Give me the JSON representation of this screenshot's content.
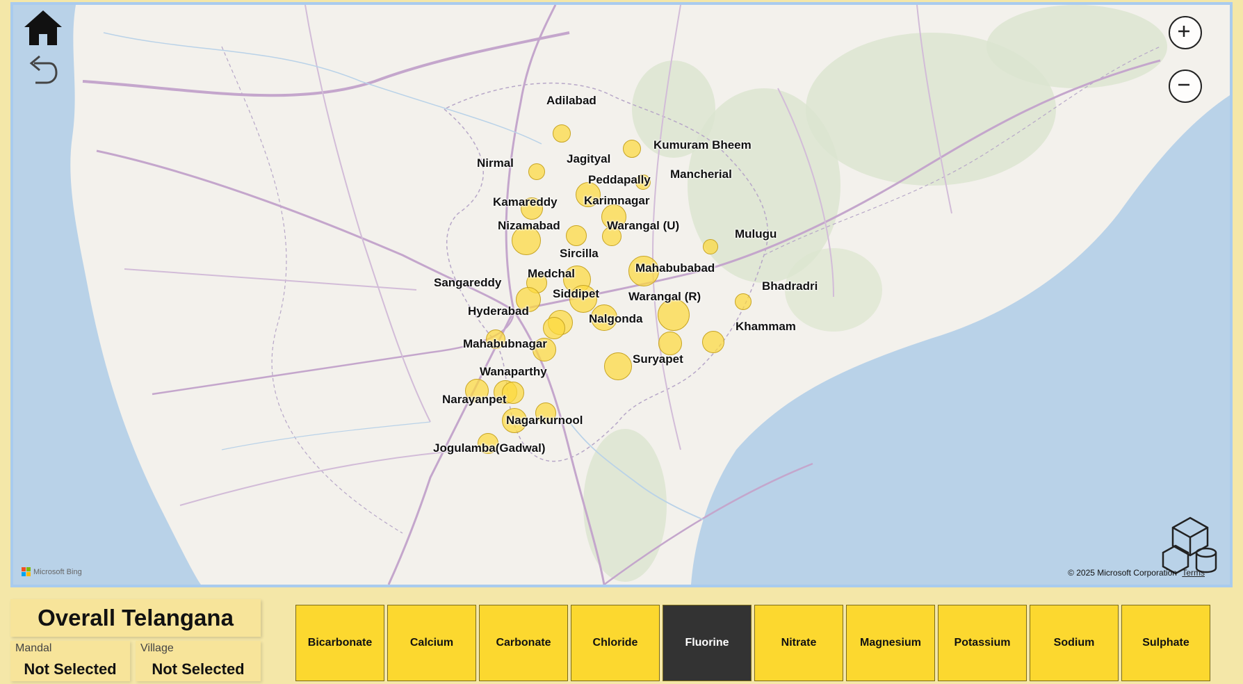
{
  "map": {
    "attribution": "Microsoft Bing",
    "copyright": "© 2025 Microsoft Corporation",
    "terms": "Terms",
    "controls": {
      "home_icon": "home-icon",
      "back_icon": "undo-icon",
      "zoom_in_icon": "plus-icon",
      "zoom_out_icon": "minus-icon",
      "layers_icon": "cube-icon"
    },
    "bubble_color": "#fcd83e",
    "districts": [
      {
        "name": "Adilabad"
      },
      {
        "name": "Kumuram Bheem"
      },
      {
        "name": "Nirmal"
      },
      {
        "name": "Jagityal"
      },
      {
        "name": "Mancherial"
      },
      {
        "name": "Peddapally"
      },
      {
        "name": "Kamareddy"
      },
      {
        "name": "Karimnagar"
      },
      {
        "name": "Nizamabad"
      },
      {
        "name": "Warangal (U)"
      },
      {
        "name": "Mulugu"
      },
      {
        "name": "Sircilla"
      },
      {
        "name": "Mahabubabad"
      },
      {
        "name": "Medchal"
      },
      {
        "name": "Sangareddy"
      },
      {
        "name": "Bhadradri"
      },
      {
        "name": "Siddipet"
      },
      {
        "name": "Warangal (R)"
      },
      {
        "name": "Hyderabad"
      },
      {
        "name": "Nalgonda"
      },
      {
        "name": "Khammam"
      },
      {
        "name": "Mahabubnagar"
      },
      {
        "name": "Suryapet"
      },
      {
        "name": "Wanaparthy"
      },
      {
        "name": "Narayanpet"
      },
      {
        "name": "Nagarkurnool"
      },
      {
        "name": "Jogulamba(Gadwal)"
      }
    ]
  },
  "header": {
    "title": "Overall Telangana"
  },
  "filters": {
    "mandal": {
      "label": "Mandal",
      "value": "Not Selected"
    },
    "village": {
      "label": "Village",
      "value": "Not Selected"
    }
  },
  "parameters": {
    "active": "Fluorine",
    "items": [
      "Bicarbonate",
      "Calcium",
      "Carbonate",
      "Chloride",
      "Fluorine",
      "Nitrate",
      "Magnesium",
      "Potassium",
      "Sodium",
      "Sulphate"
    ]
  }
}
